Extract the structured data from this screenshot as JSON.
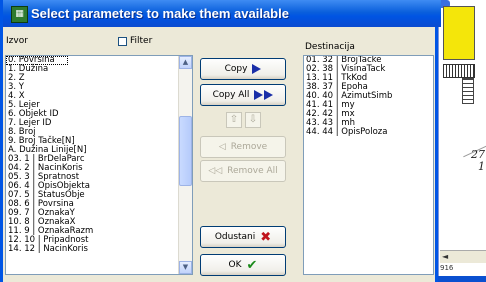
{
  "dialog": {
    "title": "Select parameters to make them available",
    "icon": "app-icon"
  },
  "izvor": {
    "label": "Izvor",
    "filter_label": "Filter",
    "filter_checked": false,
    "items": [
      "0. Površina",
      "1. Dužina",
      "2. Z",
      "3. Y",
      "4. X",
      "5. Lejer",
      "6. Objekt ID",
      "7. Lejer ID",
      "8. Broj",
      "9. Broj Tačke[N]",
      "A. Dužina Linije[N]",
      "03. 1 | BrDelaParc",
      "04. 2 | NacinKoris",
      "05. 3 | Spratnost",
      "06. 4 | OpisObjekta",
      "07. 5 | StatusObje",
      "08. 6 | Povrsina",
      "09. 7 | OznakaY",
      "10. 8 | OznakaX",
      "11. 9 | OznakaRazm",
      "12. 10 | Pripadnost",
      "14. 12 | NacinKoris"
    ],
    "selected_index": 0
  },
  "destinacija": {
    "label": "Destinacija",
    "items": [
      "01. 32 | BrojTacke",
      "02. 38 | VisinaTack",
      "13. 11 | TkKod",
      "38. 37 | Epoha",
      "40. 40 | AzimutSimb",
      "41. 41 | my",
      "42. 42 | mx",
      "43. 43 | mh",
      "44. 44 | OpisPoloza"
    ]
  },
  "buttons": {
    "copy": "Copy",
    "copy_all": "Copy All",
    "remove": "Remove",
    "remove_all": "Remove All",
    "cancel": "Odustani",
    "ok": "OK"
  },
  "background": {
    "number_1": "27",
    "number_2": "1",
    "ruler": "916"
  },
  "colors": {
    "title_bar": "#0054e3",
    "dialog_bg": "#ece9d8",
    "copy_arrow": "#1a2fa8",
    "cancel_x": "#c0141c",
    "ok_check": "#1a8a1a"
  }
}
